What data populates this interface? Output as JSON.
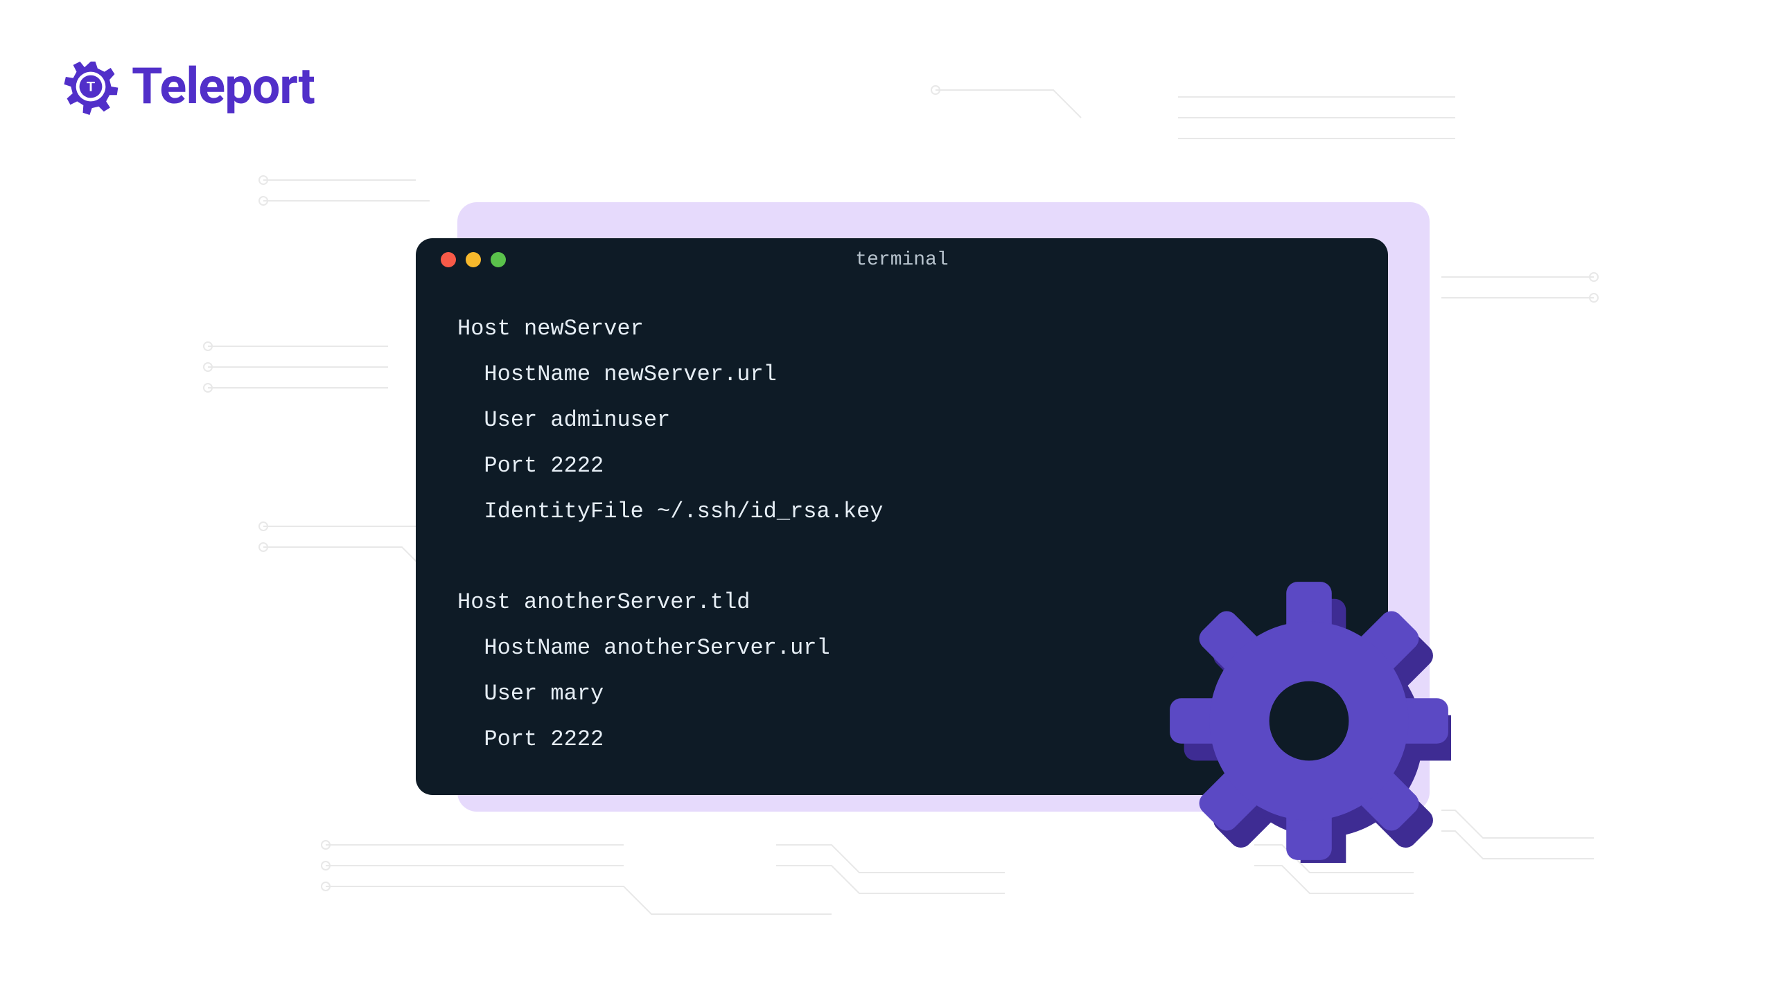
{
  "brand": {
    "name": "Teleport",
    "accent": "#512FC9"
  },
  "terminal": {
    "title": "terminal",
    "traffic_colors": {
      "red": "#F85A48",
      "yellow": "#F6B82C",
      "green": "#5AC24B"
    },
    "content": "Host newServer\n  HostName newServer.url\n  User adminuser\n  Port 2222\n  IdentityFile ~/.ssh/id_rsa.key\n\nHost anotherServer.tld\n  HostName anotherServer.url\n  User mary\n  Port 2222"
  },
  "decor": {
    "gear_icon": "gear-icon",
    "lavender": "#E6DAFC"
  }
}
